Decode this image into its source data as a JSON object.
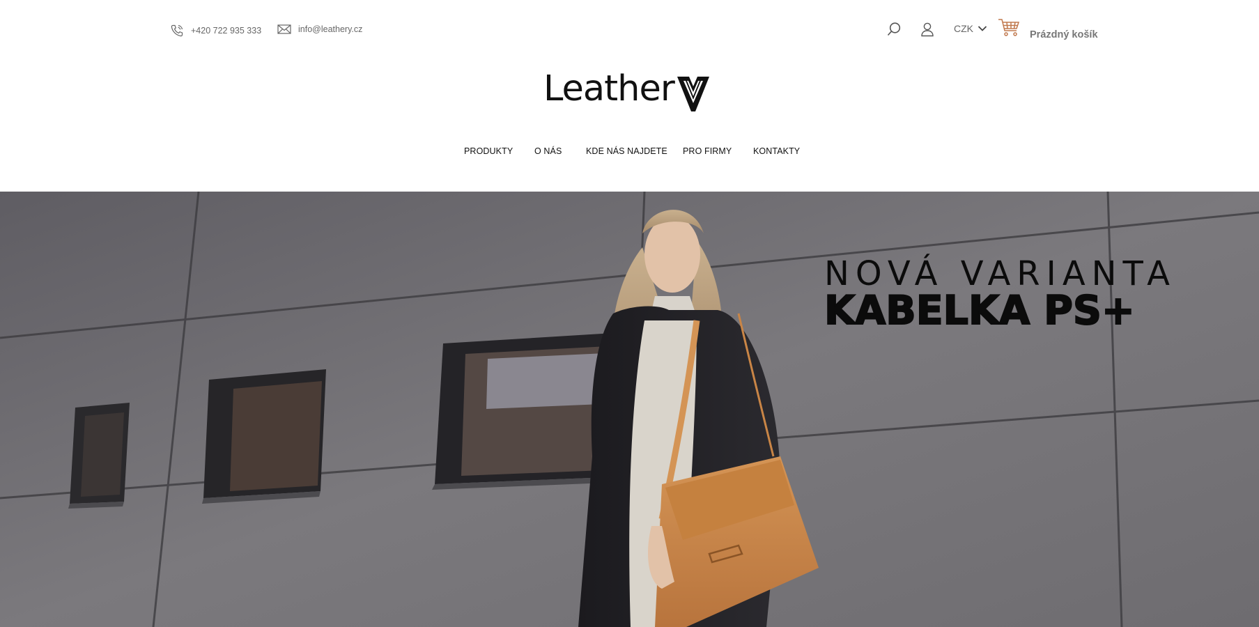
{
  "header": {
    "phone": "+420 722 935 333",
    "email": "info@leathery.cz",
    "currency": "CZK",
    "cart_label": "Prázdný košík"
  },
  "logo": {
    "text": "Leather"
  },
  "nav": {
    "items": [
      "PRODUKTY",
      "O NÁS",
      "KDE NÁS NAJDETE",
      "PRO FIRMY",
      "KONTAKTY"
    ]
  },
  "hero": {
    "line1": "NOVÁ VARIANTA",
    "line2": "KABELKA PS+"
  },
  "colors": {
    "text_dark": "#111111",
    "text_muted": "#666666",
    "cart_accent": "#c0784d",
    "bag": "#c98546"
  },
  "icons": {
    "phone": "phone-icon",
    "mail": "envelope-icon",
    "search": "search-icon",
    "user": "user-icon",
    "chevron": "chevron-down-icon",
    "cart": "cart-icon"
  }
}
